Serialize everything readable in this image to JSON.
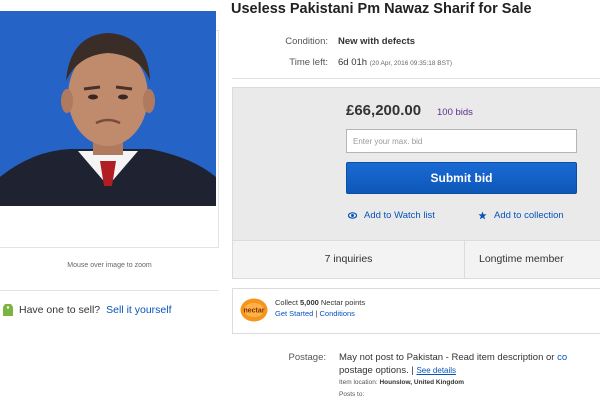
{
  "listing": {
    "title": "Useless Pakistani Pm Nawaz Sharif for Sale",
    "zoom_hint": "Mouse over image to zoom",
    "sell_question": "Have one to sell?",
    "sell_link": "Sell it yourself"
  },
  "details": {
    "condition_label": "Condition:",
    "condition_value": "New with defects",
    "time_label": "Time left:",
    "time_value": "6d 01h",
    "time_detail": "(20 Apr, 2016   09:35:18 BST)"
  },
  "bidding": {
    "price": "£66,200.00",
    "bids": "100 bids",
    "max_bid_placeholder": "Enter your max. bid",
    "submit_label": "Submit bid",
    "watch_label": "Add to Watch list",
    "collection_label": "Add to collection"
  },
  "tabs": {
    "inquiries": "7 inquiries",
    "longtime": "Longtime member"
  },
  "nectar": {
    "logo_text": "nectar",
    "collect_prefix": "Collect ",
    "points": "5,000",
    "collect_suffix": " Nectar points",
    "get_started": "Get Started",
    "separator": " | ",
    "conditions": "Conditions"
  },
  "postage": {
    "label": "Postage:",
    "line1": "May not post to Pakistan - Read item description or ",
    "line1_link": "co",
    "line2": "postage options.  |  ",
    "see_details": "See details",
    "location_label": "Item location:  ",
    "location_value": "Hounslow, United Kingdom",
    "posts_to": "Posts to:"
  },
  "colors": {
    "link": "#0654ba",
    "bids_count": "#5b2e91",
    "submit_button": "#1560c4",
    "bid_panel": "#eaeaea",
    "nectar_orange": "#f7941d",
    "photo_background": "#2a63c8"
  },
  "icons": {
    "watch": "eye-icon",
    "collection": "star-icon",
    "sell": "tag-icon"
  }
}
